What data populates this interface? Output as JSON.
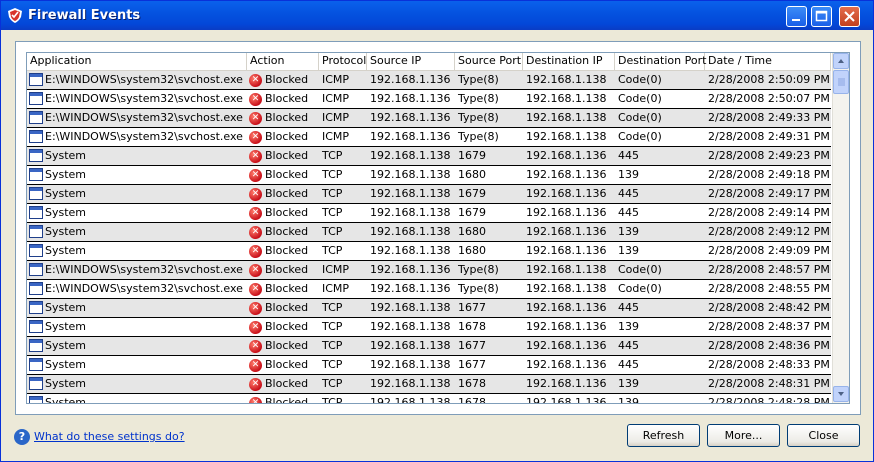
{
  "window": {
    "title": "Firewall Events"
  },
  "columns": [
    "Application",
    "Action",
    "Protocol",
    "Source IP",
    "Source Port",
    "Destination IP",
    "Destination Port",
    "Date / Time"
  ],
  "rows": [
    {
      "app": "E:\\WINDOWS\\system32\\svchost.exe",
      "action": "Blocked",
      "protocol": "ICMP",
      "src_ip": "192.168.1.136",
      "src_port": "Type(8)",
      "dst_ip": "192.168.1.138",
      "dst_port": "Code(0)",
      "datetime": "2/28/2008 2:50:09 PM"
    },
    {
      "app": "E:\\WINDOWS\\system32\\svchost.exe",
      "action": "Blocked",
      "protocol": "ICMP",
      "src_ip": "192.168.1.136",
      "src_port": "Type(8)",
      "dst_ip": "192.168.1.138",
      "dst_port": "Code(0)",
      "datetime": "2/28/2008 2:50:07 PM"
    },
    {
      "app": "E:\\WINDOWS\\system32\\svchost.exe",
      "action": "Blocked",
      "protocol": "ICMP",
      "src_ip": "192.168.1.136",
      "src_port": "Type(8)",
      "dst_ip": "192.168.1.138",
      "dst_port": "Code(0)",
      "datetime": "2/28/2008 2:49:33 PM"
    },
    {
      "app": "E:\\WINDOWS\\system32\\svchost.exe",
      "action": "Blocked",
      "protocol": "ICMP",
      "src_ip": "192.168.1.136",
      "src_port": "Type(8)",
      "dst_ip": "192.168.1.138",
      "dst_port": "Code(0)",
      "datetime": "2/28/2008 2:49:31 PM"
    },
    {
      "app": "System",
      "action": "Blocked",
      "protocol": "TCP",
      "src_ip": "192.168.1.138",
      "src_port": "1679",
      "dst_ip": "192.168.1.136",
      "dst_port": "445",
      "datetime": "2/28/2008 2:49:23 PM"
    },
    {
      "app": "System",
      "action": "Blocked",
      "protocol": "TCP",
      "src_ip": "192.168.1.138",
      "src_port": "1680",
      "dst_ip": "192.168.1.136",
      "dst_port": "139",
      "datetime": "2/28/2008 2:49:18 PM"
    },
    {
      "app": "System",
      "action": "Blocked",
      "protocol": "TCP",
      "src_ip": "192.168.1.138",
      "src_port": "1679",
      "dst_ip": "192.168.1.136",
      "dst_port": "445",
      "datetime": "2/28/2008 2:49:17 PM"
    },
    {
      "app": "System",
      "action": "Blocked",
      "protocol": "TCP",
      "src_ip": "192.168.1.138",
      "src_port": "1679",
      "dst_ip": "192.168.1.136",
      "dst_port": "445",
      "datetime": "2/28/2008 2:49:14 PM"
    },
    {
      "app": "System",
      "action": "Blocked",
      "protocol": "TCP",
      "src_ip": "192.168.1.138",
      "src_port": "1680",
      "dst_ip": "192.168.1.136",
      "dst_port": "139",
      "datetime": "2/28/2008 2:49:12 PM"
    },
    {
      "app": "System",
      "action": "Blocked",
      "protocol": "TCP",
      "src_ip": "192.168.1.138",
      "src_port": "1680",
      "dst_ip": "192.168.1.136",
      "dst_port": "139",
      "datetime": "2/28/2008 2:49:09 PM"
    },
    {
      "app": "E:\\WINDOWS\\system32\\svchost.exe",
      "action": "Blocked",
      "protocol": "ICMP",
      "src_ip": "192.168.1.136",
      "src_port": "Type(8)",
      "dst_ip": "192.168.1.138",
      "dst_port": "Code(0)",
      "datetime": "2/28/2008 2:48:57 PM"
    },
    {
      "app": "E:\\WINDOWS\\system32\\svchost.exe",
      "action": "Blocked",
      "protocol": "ICMP",
      "src_ip": "192.168.1.136",
      "src_port": "Type(8)",
      "dst_ip": "192.168.1.138",
      "dst_port": "Code(0)",
      "datetime": "2/28/2008 2:48:55 PM"
    },
    {
      "app": "System",
      "action": "Blocked",
      "protocol": "TCP",
      "src_ip": "192.168.1.138",
      "src_port": "1677",
      "dst_ip": "192.168.1.136",
      "dst_port": "445",
      "datetime": "2/28/2008 2:48:42 PM"
    },
    {
      "app": "System",
      "action": "Blocked",
      "protocol": "TCP",
      "src_ip": "192.168.1.138",
      "src_port": "1678",
      "dst_ip": "192.168.1.136",
      "dst_port": "139",
      "datetime": "2/28/2008 2:48:37 PM"
    },
    {
      "app": "System",
      "action": "Blocked",
      "protocol": "TCP",
      "src_ip": "192.168.1.138",
      "src_port": "1677",
      "dst_ip": "192.168.1.136",
      "dst_port": "445",
      "datetime": "2/28/2008 2:48:36 PM"
    },
    {
      "app": "System",
      "action": "Blocked",
      "protocol": "TCP",
      "src_ip": "192.168.1.138",
      "src_port": "1677",
      "dst_ip": "192.168.1.136",
      "dst_port": "445",
      "datetime": "2/28/2008 2:48:33 PM"
    },
    {
      "app": "System",
      "action": "Blocked",
      "protocol": "TCP",
      "src_ip": "192.168.1.138",
      "src_port": "1678",
      "dst_ip": "192.168.1.136",
      "dst_port": "139",
      "datetime": "2/28/2008 2:48:31 PM"
    },
    {
      "app": "System",
      "action": "Blocked",
      "protocol": "TCP",
      "src_ip": "192.168.1.138",
      "src_port": "1678",
      "dst_ip": "192.168.1.136",
      "dst_port": "139",
      "datetime": "2/28/2008 2:48:28 PM"
    }
  ],
  "footer": {
    "help_link": "What do these settings do?",
    "refresh_label": "Refresh",
    "more_label": "More...",
    "close_label": "Close"
  },
  "icons": {
    "app": "window-app-icon",
    "blocked": "blocked-x-icon",
    "help": "help-question-icon"
  },
  "colors": {
    "titlebar": "#0553e0",
    "blocked": "#c8101a",
    "link": "#0033cc"
  }
}
